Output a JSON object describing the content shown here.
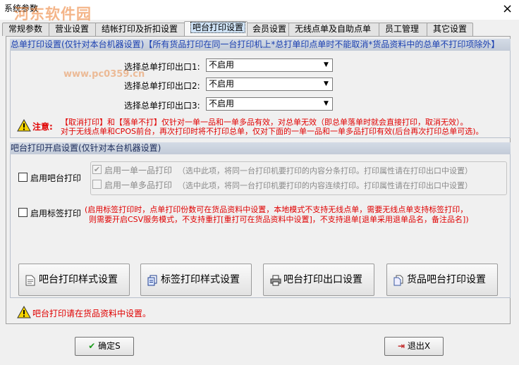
{
  "window": {
    "title": "系统参数",
    "watermark": "河东软件园",
    "watermark_url": "www.pc0359.cn",
    "close": "×"
  },
  "tabs": [
    {
      "label": "常规参数"
    },
    {
      "label": "营业设置"
    },
    {
      "label": "结帐打印及折扣设置"
    },
    {
      "label": "吧台打印设置",
      "active": true
    },
    {
      "label": "会员设置"
    },
    {
      "label": "无线点单及自助点单"
    },
    {
      "label": "员工管理"
    },
    {
      "label": "其它设置"
    }
  ],
  "summary_print": {
    "header_prefix": "总单打印设置(仅针对本台机器设置)",
    "header_note": "【所有货品打印在同一台打印机上*总打单印点单时不能取消*货品资料中的总单不打印项除外】",
    "rows": [
      {
        "label": "选择总单打印出口1:",
        "value": "不启用"
      },
      {
        "label": "选择总单打印出口2:",
        "value": "不启用"
      },
      {
        "label": "选择总单打印出口3:",
        "value": "不启用"
      }
    ],
    "note_label": "注意:",
    "note_line1": "【取消打印】和【落单不打】仅针对一单一品和一单多品有效，对总单无效（即总单落单时就会直接打印，取消无效）。",
    "note_line2": "对于无线点单和CPOS前台，再次打印时将不打印总单，仅对下面的一单一品和一单多品打印有效(后台再次打印总单可选)。"
  },
  "bar_print": {
    "header": "吧台打印开启设置(仅针对本台机器设置)",
    "enable_bar_label": "启用吧台打印",
    "enable_bar_checked": false,
    "one_item_label": "启用一单一品打印",
    "one_item_checked": true,
    "one_item_note": "（选中此项，将同一台打印机要打印的内容分条打印。打印属性请在打印出口中设置）",
    "multi_item_label": "启用一单多品打印",
    "multi_item_checked": false,
    "multi_item_note": "（选中此项，将同一台打印机要打印的内容连续打印。打印属性请在打印出口中设置）",
    "enable_label_label": "启用标签打印",
    "enable_label_checked": false,
    "label_note_line1": "(启用标签打印时，点单打印份数可在货品资料中设置，本地模式不支持无线点单，需要无线点单支持标签打印，",
    "label_note_line2": "则需要开启CSV服务模式，不支持重打[重打可在货品资料中设置]，不支持退单[退单采用退单品名，备注品名])"
  },
  "buttons": {
    "bar_style": "吧台打印样式设置",
    "label_style": "标签打印样式设置",
    "bar_output": "吧台打印出口设置",
    "goods_bar": "货品吧台打印设置"
  },
  "footer_note": "吧台打印请在货品资料中设置。",
  "dialog": {
    "ok": "确定S",
    "exit": "退出X"
  },
  "colors": {
    "warning": "#e00000",
    "header_blue": "#1a3fb0"
  }
}
